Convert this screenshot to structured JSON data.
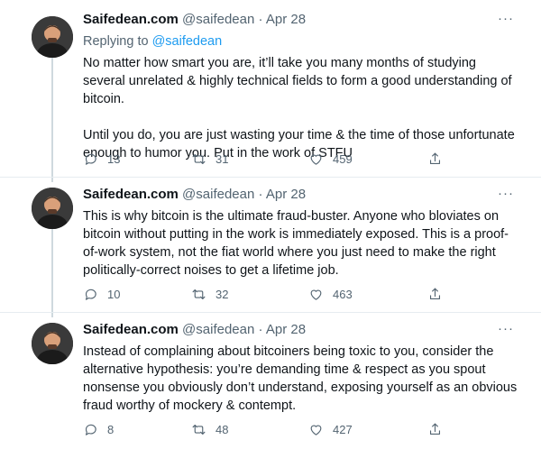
{
  "tweets": [
    {
      "name": "Saifedean.com",
      "handle": "@saifedean",
      "separator": "·",
      "date": "Apr 28",
      "more": "···",
      "replying_prefix": "Replying to ",
      "replying_to": "@saifedean",
      "paragraphs": [
        "No matter how smart you are, it’ll take you many months of studying several unrelated & highly technical fields to form a good understanding of bitcoin.",
        "Until you do, you are just wasting your time & the time of those unfortunate enough to humor you. Put in the work of STFU"
      ],
      "replies": "13",
      "retweets": "31",
      "likes": "459"
    },
    {
      "name": "Saifedean.com",
      "handle": "@saifedean",
      "separator": "·",
      "date": "Apr 28",
      "more": "···",
      "paragraphs": [
        "This is why bitcoin is the ultimate fraud-buster. Anyone who bloviates on bitcoin without putting in the work is immediately exposed. This is a proof-of-work system, not the fiat world where you just need to make the right politically-correct noises to get a lifetime job."
      ],
      "replies": "10",
      "retweets": "32",
      "likes": "463"
    },
    {
      "name": "Saifedean.com",
      "handle": "@saifedean",
      "separator": "·",
      "date": "Apr 28",
      "more": "···",
      "paragraphs": [
        "Instead of complaining about bitcoiners being toxic to you, consider the alternative hypothesis: you’re demanding time & respect as you spout nonsense you obviously don’t understand, exposing yourself as an obvious fraud worthy of mockery & contempt."
      ],
      "replies": "8",
      "retweets": "48",
      "likes": "427"
    }
  ],
  "icons": {
    "reply": "reply-icon",
    "retweet": "retweet-icon",
    "like": "heart-icon",
    "share": "share-icon",
    "more": "more-icon"
  },
  "colors": {
    "text": "#0f1419",
    "muted": "#536471",
    "link": "#1d9bf0",
    "thread_line": "#cfd9de"
  }
}
